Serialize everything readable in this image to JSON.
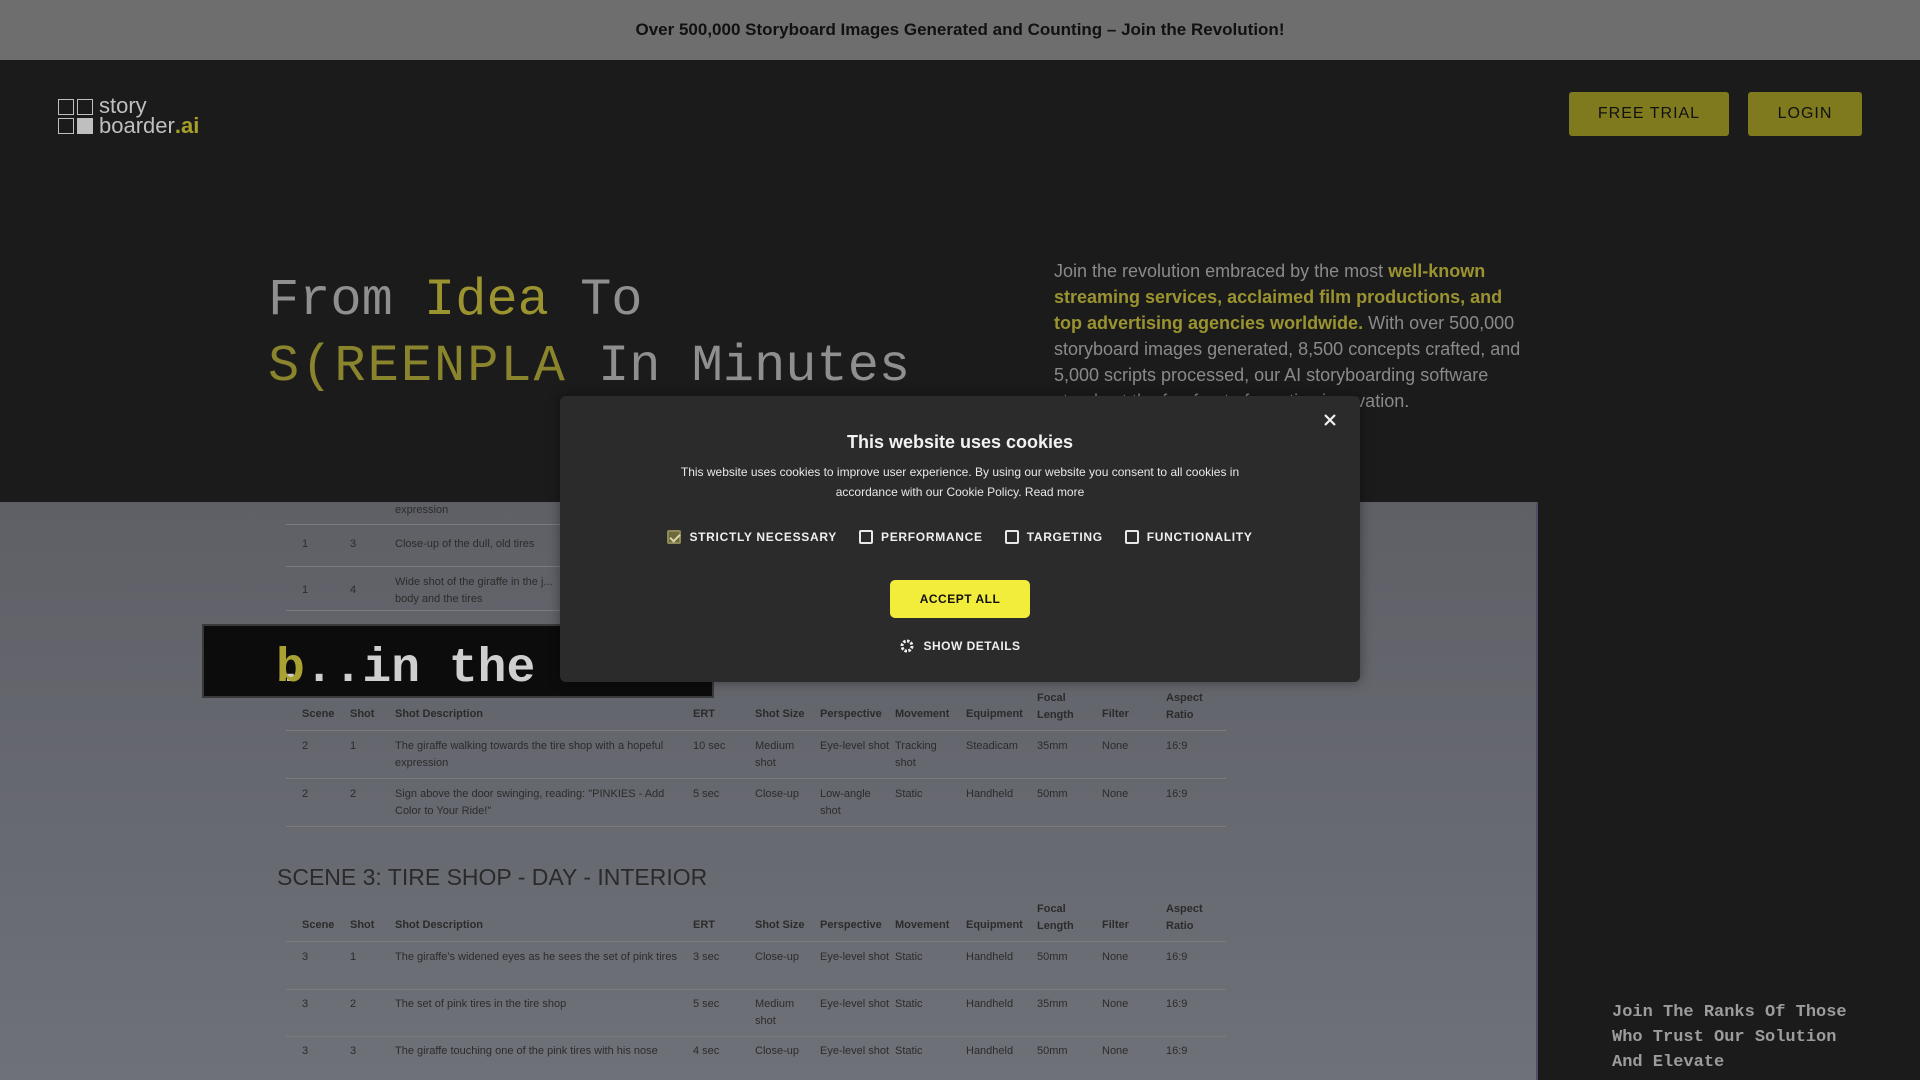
{
  "banner": {
    "text": "Over 500,000 Storyboard Images Generated and Counting – Join the Revolution!"
  },
  "logo": {
    "line1": "story",
    "line2_prefix": "boarder",
    "line2_suffix": ".ai"
  },
  "nav": {
    "free_trial": "FREE TRIAL",
    "login": "LOGIN"
  },
  "hero": {
    "title_line1_a": "From ",
    "title_line1_b": "Idea",
    "title_line1_c": " To",
    "title_line2_anim": "S(REENPLA",
    "title_line2_rest": " In Minutes",
    "text_a": "Join the revolution embraced by the most ",
    "text_hl": "well-known streaming services, acclaimed film productions, and top advertising agencies worldwide.",
    "text_b": " With over 500,000 storyboard images generated, 8,500 concepts crafted, and 5,000 scripts processed, our AI storyboarding software stands at the forefront of creative innovation."
  },
  "overlay_bar": {
    "text_a": "...in the ",
    "text_hl": "b"
  },
  "side": {
    "text": "Join The Ranks Of Those Who Trust Our Solution And Elevate"
  },
  "doc": {
    "top_rows": [
      {
        "scene": "",
        "shot": "",
        "desc": "expression"
      },
      {
        "scene": "1",
        "shot": "3",
        "desc": "Close-up of the dull, old tires"
      },
      {
        "scene": "1",
        "shot": "4",
        "desc": "Wide shot of the giraffe in the j...",
        "desc2": "body and the tires"
      }
    ],
    "headers": [
      "Scene",
      "Shot",
      "Shot Description",
      "ERT",
      "Shot Size",
      "Perspective",
      "Movement",
      "Equipment",
      "Focal Length",
      "Filter",
      "Aspect Ratio"
    ],
    "scene2_rows": [
      [
        "2",
        "1",
        "The giraffe walking towards the tire shop with a hopeful expression",
        "10 sec",
        "Medium shot",
        "Eye-level shot",
        "Tracking shot",
        "Steadicam",
        "35mm",
        "None",
        "16:9"
      ],
      [
        "2",
        "2",
        "Sign above the door swinging, reading: \"PINKIES - Add Color to Your Ride!\"",
        "5 sec",
        "Close-up",
        "Low-angle shot",
        "Static",
        "Handheld",
        "50mm",
        "None",
        "16:9"
      ]
    ],
    "scene3_title": "SCENE 3: TIRE SHOP - DAY - INTERIOR",
    "scene3_rows": [
      [
        "3",
        "1",
        "The giraffe's widened eyes as he sees the set of pink tires",
        "3 sec",
        "Close-up",
        "Eye-level shot",
        "Static",
        "Handheld",
        "50mm",
        "None",
        "16:9"
      ],
      [
        "3",
        "2",
        "The set of pink tires in the tire shop",
        "5 sec",
        "Medium shot",
        "Eye-level shot",
        "Static",
        "Handheld",
        "35mm",
        "None",
        "16:9"
      ],
      [
        "3",
        "3",
        "The giraffe touching one of the pink tires with his nose",
        "4 sec",
        "Close-up",
        "Eye-level shot",
        "Static",
        "Handheld",
        "50mm",
        "None",
        "16:9"
      ]
    ]
  },
  "cookie": {
    "title": "This website uses cookies",
    "body": "This website uses cookies to improve user experience. By using our website you consent to all cookies in accordance with our Cookie Policy. Read more",
    "options": [
      {
        "label": "STRICTLY NECESSARY",
        "checked": true
      },
      {
        "label": "PERFORMANCE",
        "checked": false
      },
      {
        "label": "TARGETING",
        "checked": false
      },
      {
        "label": "FUNCTIONALITY",
        "checked": false
      }
    ],
    "accept": "ACCEPT ALL",
    "details": "SHOW DETAILS"
  },
  "colors": {
    "accent": "#f2ec3a",
    "brand_olive": "#7f7a1e",
    "modal_bg": "#2b2b2b"
  }
}
